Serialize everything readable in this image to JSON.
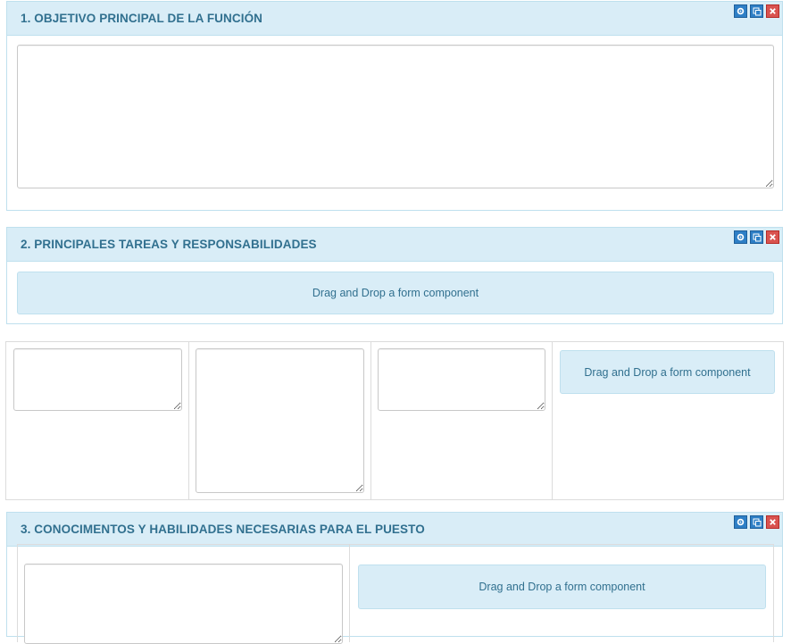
{
  "sections": [
    {
      "title": "1. OBJETIVO PRINCIPAL DE LA FUNCIÓN"
    },
    {
      "title": "2. PRINCIPALES TAREAS Y RESPONSABILIDADES",
      "dropzone": "Drag and Drop a form component"
    },
    {
      "title": "3. CONOCIMENTOS Y HABILIDADES NECESARIAS PARA EL PUESTO",
      "dropzone": "Drag and Drop a form component"
    }
  ],
  "columns_row": {
    "dropzone": "Drag and Drop a form component"
  },
  "tool_icons": [
    "gear-icon",
    "copy-icon",
    "close-icon"
  ],
  "colors": {
    "header_bg": "#d9edf7",
    "header_text": "#31708f",
    "tool_blue": "#2e7fc6",
    "tool_red": "#d9534f"
  }
}
